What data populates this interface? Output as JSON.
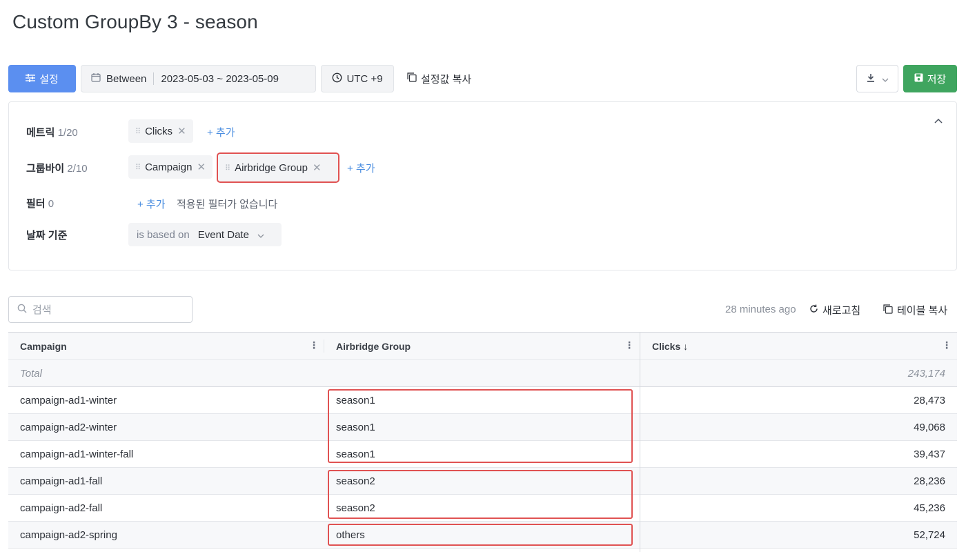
{
  "page": {
    "title": "Custom GroupBy 3 - season"
  },
  "toolbar": {
    "settings_label": "설정",
    "date_mode": "Between",
    "date_range": "2023-05-03 ~ 2023-05-09",
    "timezone": "UTC +9",
    "copy_settings_label": "설정값 복사",
    "save_label": "저장"
  },
  "panel": {
    "metrics": {
      "label": "메트릭",
      "count": "1/20",
      "chips": [
        "Clicks"
      ],
      "add": "+ 추가"
    },
    "groupby": {
      "label": "그룹바이",
      "count": "2/10",
      "chips": [
        "Campaign",
        "Airbridge Group"
      ],
      "add": "+ 추가"
    },
    "filter": {
      "label": "필터",
      "count": "0",
      "add": "+ 추가",
      "empty_text": "적용된 필터가 없습니다"
    },
    "date_basis": {
      "label": "날짜 기준",
      "prefix": "is based on",
      "value": "Event Date"
    }
  },
  "table_tools": {
    "search_placeholder": "검색",
    "updated": "28 minutes ago",
    "refresh_label": "새로고침",
    "copy_table_label": "테이블 복사"
  },
  "table": {
    "columns": [
      "Campaign",
      "Airbridge Group",
      "Clicks ↓"
    ],
    "total": {
      "label": "Total",
      "clicks": "243,174"
    },
    "rows": [
      {
        "campaign": "campaign-ad1-winter",
        "group": "season1",
        "clicks": "28,473"
      },
      {
        "campaign": "campaign-ad2-winter",
        "group": "season1",
        "clicks": "49,068"
      },
      {
        "campaign": "campaign-ad1-winter-fall",
        "group": "season1",
        "clicks": "39,437"
      },
      {
        "campaign": "campaign-ad1-fall",
        "group": "season2",
        "clicks": "28,236"
      },
      {
        "campaign": "campaign-ad2-fall",
        "group": "season2",
        "clicks": "45,236"
      },
      {
        "campaign": "campaign-ad2-spring",
        "group": "others",
        "clicks": "52,724"
      }
    ]
  },
  "colors": {
    "primary": "#5b8ff0",
    "save": "#3fa55f",
    "highlight": "#e05252",
    "link": "#4a8de0"
  }
}
